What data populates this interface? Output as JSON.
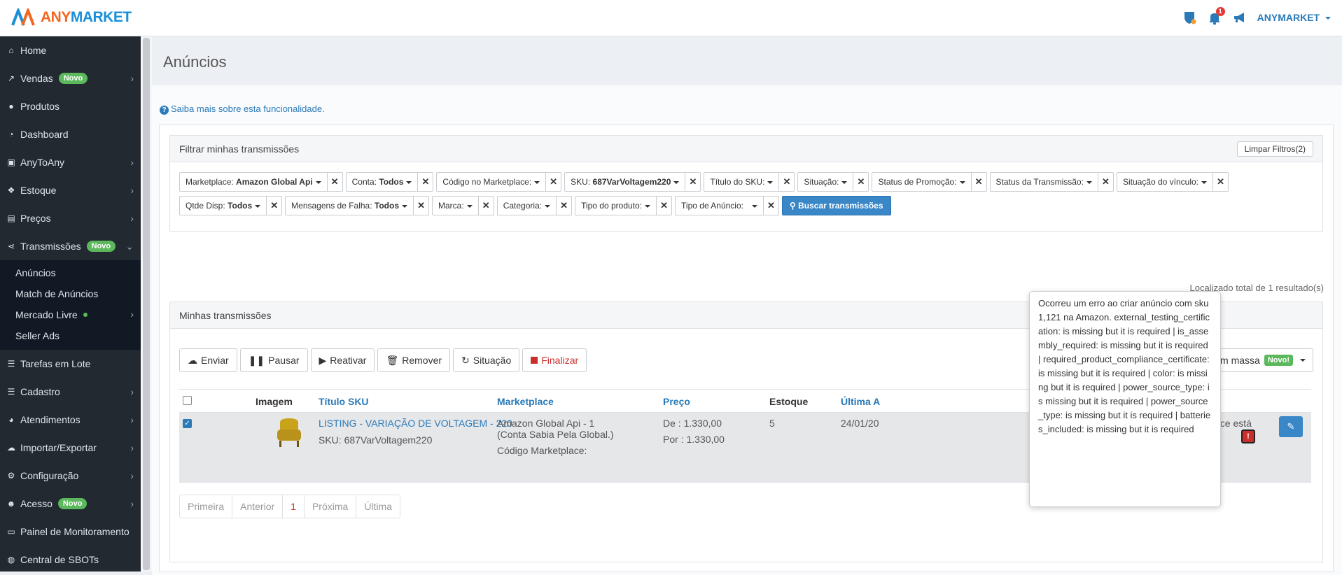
{
  "brand": {
    "any": "ANY",
    "market": "MARKET"
  },
  "topbar": {
    "notif_count": "1",
    "user": "ANYMARKET"
  },
  "sidebar": {
    "items": [
      {
        "label": "Home"
      },
      {
        "label": "Vendas",
        "badge": "Novo"
      },
      {
        "label": "Produtos"
      },
      {
        "label": "Dashboard"
      },
      {
        "label": "AnyToAny"
      },
      {
        "label": "Estoque"
      },
      {
        "label": "Preços"
      },
      {
        "label": "Transmissões",
        "badge": "Novo"
      }
    ],
    "sub_items": [
      {
        "label": "Anúncios"
      },
      {
        "label": "Match de Anúncios"
      },
      {
        "label": "Mercado Livre"
      },
      {
        "label": "Seller Ads"
      }
    ],
    "items_after": [
      {
        "label": "Tarefas em Lote"
      },
      {
        "label": "Cadastro"
      },
      {
        "label": "Atendimentos"
      },
      {
        "label": "Importar/Exportar"
      },
      {
        "label": "Configuração"
      },
      {
        "label": "Acesso",
        "badge": "Novo"
      },
      {
        "label": "Painel de Monitoramento"
      },
      {
        "label": "Central de SBOTs"
      }
    ]
  },
  "page": {
    "title": "Anúncios",
    "info_link": "Saiba mais sobre esta funcionalidade."
  },
  "filters": {
    "title": "Filtrar minhas transmissões",
    "clear_label": "Limpar Filtros(2)",
    "row1": [
      {
        "label": "Marketplace:",
        "value": "Amazon Global Api"
      },
      {
        "label": "Conta:",
        "value": "Todos"
      },
      {
        "label": "Código no Marketplace:",
        "value": ""
      },
      {
        "label": "SKU:",
        "value": "687VarVoltagem220"
      },
      {
        "label": "Título do SKU:",
        "value": ""
      },
      {
        "label": "Situação:",
        "value": ""
      },
      {
        "label": "Status de Promoção:",
        "value": ""
      },
      {
        "label": "Status da Transmissão:",
        "value": ""
      },
      {
        "label": "Situação do vínculo:",
        "value": ""
      }
    ],
    "row2": [
      {
        "label": "Qtde Disp:",
        "value": "Todos"
      },
      {
        "label": "Mensagens de Falha:",
        "value": "Todos"
      },
      {
        "label": "Marca:",
        "value": ""
      },
      {
        "label": "Categoria:",
        "value": ""
      },
      {
        "label": "Tipo do produto:",
        "value": ""
      },
      {
        "label": "Tipo de Anúncio:",
        "value": ""
      }
    ],
    "search_label": "Buscar transmissões"
  },
  "results": {
    "total_text": "Localizado total de 1 resultado(s)"
  },
  "list": {
    "title": "Minhas transmissões",
    "actions": [
      "Enviar",
      "Pausar",
      "Reativar",
      "Remover",
      "Situação",
      "Finalizar"
    ],
    "mass_label": "m massa",
    "mass_badge": "Novo!",
    "headers": {
      "image": "Imagem",
      "title": "Título SKU",
      "marketplace": "Marketplace",
      "price": "Preço",
      "stock": "Estoque",
      "last": "Última A"
    },
    "row": {
      "title": "LISTING - VARIAÇÃO DE VOLTAGEM - 220",
      "sku": "SKU: 687VarVoltagem220",
      "marketplace_line1": "Amazon Global Api - 1",
      "marketplace_line2": "(Conta Sabia Pela Global.)",
      "marketplace_code": "Código Marketplace:",
      "price_from": "De : 1.330,00",
      "price_to": "Por : 1.330,00",
      "stock": "5",
      "last_update": "24/01/20",
      "status_text": "ace está"
    }
  },
  "pagination": [
    "Primeira",
    "Anterior",
    "1",
    "Próxima",
    "Última"
  ],
  "tooltip": {
    "text": "Ocorreu um erro ao criar anúncio com sku 1,121 na Amazon. external_testing_certification: is missing but it is required | is_assembly_required: is missing but it is required | required_product_compliance_certificate: is missing but it is required | color: is missing but it is required | power_source_type: is missing but it is required | power_source_type: is missing but it is required | batteries_included: is missing but it is required"
  }
}
